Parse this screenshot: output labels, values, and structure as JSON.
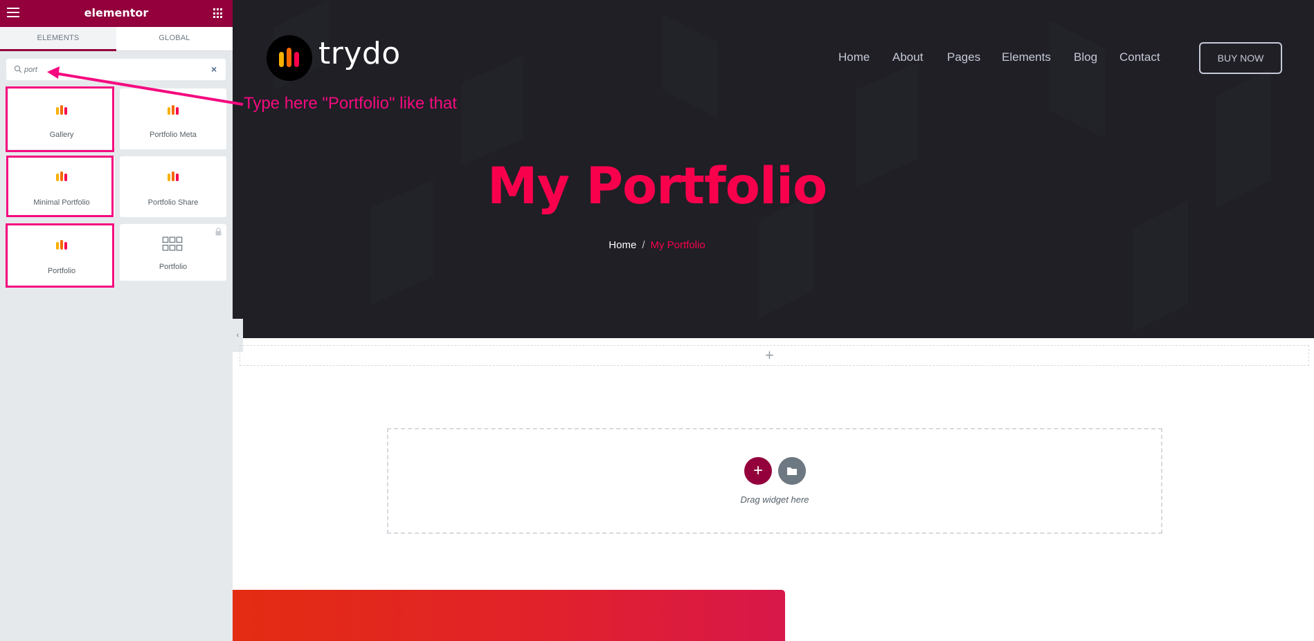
{
  "panel": {
    "title": "elementor",
    "tabs": [
      "ELEMENTS",
      "GLOBAL"
    ],
    "search": {
      "value": "port",
      "clear": "×"
    },
    "widgets": [
      {
        "label": "Gallery",
        "icon": "trydo-bars-icon",
        "highlighted": true
      },
      {
        "label": "Portfolio Meta",
        "icon": "trydo-bars-icon",
        "highlighted": false
      },
      {
        "label": "Minimal Portfolio",
        "icon": "trydo-bars-icon",
        "highlighted": true
      },
      {
        "label": "Portfolio Share",
        "icon": "trydo-bars-icon",
        "highlighted": false
      },
      {
        "label": "Portfolio",
        "icon": "trydo-bars-icon",
        "highlighted": true
      },
      {
        "label": "Portfolio",
        "icon": "grid-icon",
        "highlighted": false,
        "locked": true
      }
    ]
  },
  "site": {
    "logo_text": "trydo",
    "nav": [
      "Home",
      "About",
      "Pages",
      "Elements",
      "Blog",
      "Contact"
    ],
    "buy_button": "BUY NOW",
    "hero_title": "My Portfolio",
    "breadcrumb": {
      "home": "Home",
      "separator": "/",
      "current": "My Portfolio"
    }
  },
  "editor": {
    "add_plus": "+",
    "add_section_plus": "+",
    "drag_text": "Drag widget here"
  },
  "annotation": {
    "text": "Type here \"Portfolio\" like that"
  },
  "colors": {
    "elementor": "#93003c",
    "accent": "#f9004d",
    "highlight": "#f50a80",
    "hero_bg": "#1f1f25"
  }
}
